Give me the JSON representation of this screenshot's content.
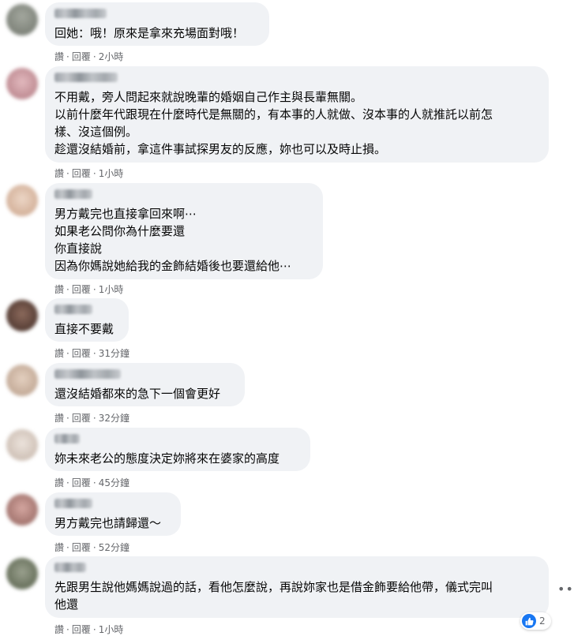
{
  "action_labels": {
    "like": "讚",
    "reply": "回覆",
    "separator": "·"
  },
  "comments": [
    {
      "text": [
        "回她：哦！原來是拿來充場面對哦！"
      ],
      "time": "2小時",
      "avatar_color": "#8a8f86"
    },
    {
      "text": [
        "不用戴，旁人問起來就說晚輩的婚姻自己作主與長輩無關。",
        "以前什麼年代跟現在什麼時代是無關的，有本事的人就做、沒本事的人就推託以前怎",
        "樣、沒這個例。",
        "趁還沒結婚前，拿這件事試探男友的反應，妳也可以及時止損。"
      ],
      "time": "1小時",
      "avatar_color": "#c48f96"
    },
    {
      "text": [
        "男方戴完也直接拿回來啊⋯",
        "如果老公問你為什麼要還",
        "你直接說",
        "因為你媽說她給我的金飾結婚後也要還給他⋯"
      ],
      "time": "1小時",
      "avatar_color": "#d9b9a3"
    },
    {
      "text": [
        "直接不要戴"
      ],
      "time": "31分鐘",
      "avatar_color": "#5a3e34"
    },
    {
      "text": [
        "還沒結婚都來的急下一個會更好"
      ],
      "time": "32分鐘",
      "avatar_color": "#cbb3a0"
    },
    {
      "text": [
        "妳未來老公的態度決定妳將來在婆家的高度"
      ],
      "time": "45分鐘",
      "avatar_color": "#d5c8bf"
    },
    {
      "text": [
        "男方戴完也請歸還～"
      ],
      "time": "52分鐘",
      "avatar_color": "#b07c76"
    },
    {
      "text": [
        "先跟男生說他媽媽說過的話，看他怎麼說，再說妳家也是借金飾要給他帶，儀式完叫",
        "他還"
      ],
      "time": "1小時",
      "avatar_color": "#6f7a62"
    }
  ],
  "last_comment": {
    "reaction_count": "2",
    "more_icon": "more-horizontal-icon",
    "reaction_icon": "like-icon"
  }
}
